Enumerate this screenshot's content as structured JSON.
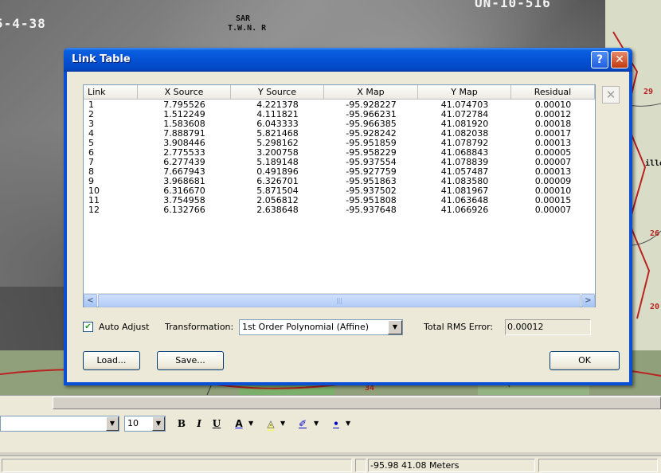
{
  "map": {
    "labels": [
      "5-4-38",
      "UN-10-516"
    ],
    "small_labels": [
      "SAR",
      "T.W.N. R",
      "29",
      "ille",
      "26",
      "34",
      "20"
    ]
  },
  "dialog": {
    "title": "Link Table",
    "help_label": "?",
    "close_label": "✕",
    "columns": [
      "Link",
      "X Source",
      "Y Source",
      "X Map",
      "Y Map",
      "Residual"
    ],
    "rows": [
      [
        "1",
        "7.795526",
        "4.221378",
        "-95.928227",
        "41.074703",
        "0.00010"
      ],
      [
        "2",
        "1.512249",
        "4.111821",
        "-95.966231",
        "41.072784",
        "0.00012"
      ],
      [
        "3",
        "1.583608",
        "6.043333",
        "-95.966385",
        "41.081920",
        "0.00018"
      ],
      [
        "4",
        "7.888791",
        "5.821468",
        "-95.928242",
        "41.082038",
        "0.00017"
      ],
      [
        "5",
        "3.908446",
        "5.298162",
        "-95.951859",
        "41.078792",
        "0.00013"
      ],
      [
        "6",
        "2.775533",
        "3.200758",
        "-95.958229",
        "41.068843",
        "0.00005"
      ],
      [
        "7",
        "6.277439",
        "5.189148",
        "-95.937554",
        "41.078839",
        "0.00007"
      ],
      [
        "8",
        "7.667943",
        "0.491896",
        "-95.927759",
        "41.057487",
        "0.00013"
      ],
      [
        "9",
        "3.968681",
        "6.326701",
        "-95.951863",
        "41.083580",
        "0.00009"
      ],
      [
        "10",
        "6.316670",
        "5.871504",
        "-95.937502",
        "41.081967",
        "0.00010"
      ],
      [
        "11",
        "3.754958",
        "2.056812",
        "-95.951808",
        "41.063648",
        "0.00015"
      ],
      [
        "12",
        "6.132766",
        "2.638648",
        "-95.937648",
        "41.066926",
        "0.00007"
      ]
    ],
    "delete_icon": "✕",
    "auto_adjust": {
      "label": "Auto Adjust",
      "checked": true,
      "check_glyph": "✔"
    },
    "transformation_label": "Transformation:",
    "transformation_value": "1st Order Polynomial (Affine)",
    "rms_label": "Total RMS Error:",
    "rms_value": "0.00012",
    "load_label": "Load...",
    "save_label": "Save...",
    "ok_label": "OK"
  },
  "format_bar": {
    "font_size": "10",
    "bold": "B",
    "italic": "I",
    "underline": "U",
    "font_color_glyph": "A",
    "fill_color_glyph": "◬",
    "line_color_glyph": "✐",
    "marker_color_glyph": "•",
    "arrow_glyph": "▼",
    "colors": {
      "font": "#0000ff",
      "fill": "#ffff00",
      "line": "#0000cc",
      "marker": "#0000cc"
    }
  },
  "status_bar": {
    "coordinates": "-95.98  41.08 Meters"
  }
}
